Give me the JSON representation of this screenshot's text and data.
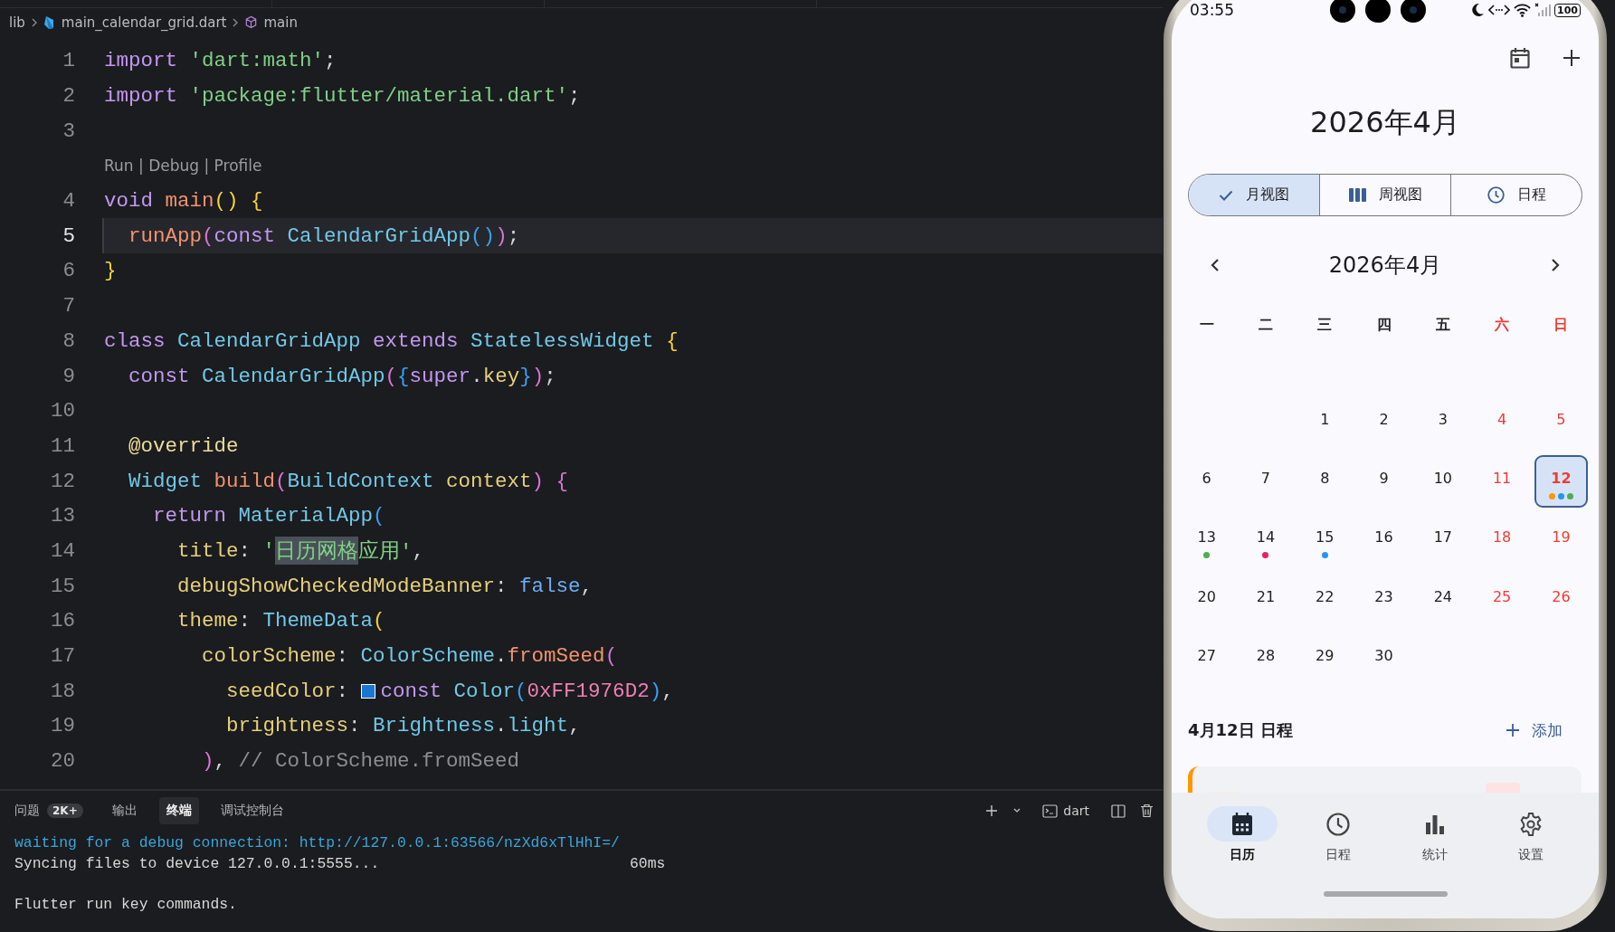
{
  "breadcrumb": [
    {
      "text": "lib",
      "kind": "folder"
    },
    {
      "text": "main_calendar_grid.dart",
      "kind": "dart"
    },
    {
      "text": "main",
      "kind": "symbol"
    }
  ],
  "editor": {
    "lines": [
      {
        "kind": "code",
        "number": "1",
        "current": false,
        "tokens": [
          {
            "text": "import ",
            "kind": "kw"
          },
          {
            "text": "'dart:math'",
            "kind": "str"
          },
          {
            "text": ";",
            "kind": "punc"
          }
        ]
      },
      {
        "kind": "code",
        "number": "2",
        "current": false,
        "tokens": [
          {
            "text": "import ",
            "kind": "kw"
          },
          {
            "text": "'package:flutter/material.dart'",
            "kind": "str"
          },
          {
            "text": ";",
            "kind": "punc"
          }
        ]
      },
      {
        "kind": "code",
        "number": "3",
        "current": false
      },
      {
        "kind": "codelens",
        "text": "Run | Debug | Profile"
      },
      {
        "kind": "code",
        "number": "4",
        "current": false,
        "tokens": [
          {
            "text": "void ",
            "kind": "kw"
          },
          {
            "text": "main",
            "kind": "fn"
          },
          {
            "text": "() {",
            "kind": "b1"
          }
        ]
      },
      {
        "kind": "code",
        "number": "5",
        "current": true,
        "tokens": [
          {
            "text": "  runApp",
            "kind": "fn"
          },
          {
            "text": "(",
            "kind": "b2"
          },
          {
            "text": "const ",
            "kind": "kw"
          },
          {
            "text": "CalendarGridApp",
            "kind": "type"
          },
          {
            "text": "()",
            "kind": "b3"
          },
          {
            "text": ")",
            "kind": "b2"
          },
          {
            "text": ";",
            "kind": "punc"
          }
        ]
      },
      {
        "kind": "code",
        "number": "6",
        "current": false,
        "tokens": [
          {
            "text": "}",
            "kind": "b1"
          }
        ]
      },
      {
        "kind": "code",
        "number": "7",
        "current": false
      },
      {
        "kind": "code",
        "number": "8",
        "current": false,
        "tokens": [
          {
            "text": "class ",
            "kind": "kw"
          },
          {
            "text": "CalendarGridApp ",
            "kind": "type"
          },
          {
            "text": "extends ",
            "kind": "kw"
          },
          {
            "text": "StatelessWidget ",
            "kind": "type"
          },
          {
            "text": "{",
            "kind": "b1"
          }
        ]
      },
      {
        "kind": "code",
        "number": "9",
        "current": false,
        "tokens": [
          {
            "text": "  const ",
            "kind": "kw"
          },
          {
            "text": "CalendarGridApp",
            "kind": "type"
          },
          {
            "text": "(",
            "kind": "b2"
          },
          {
            "text": "{",
            "kind": "b3"
          },
          {
            "text": "super",
            "kind": "kw"
          },
          {
            "text": ".",
            "kind": "punc"
          },
          {
            "text": "key",
            "kind": "prop"
          },
          {
            "text": "}",
            "kind": "b3"
          },
          {
            "text": ")",
            "kind": "b2"
          },
          {
            "text": ";",
            "kind": "punc"
          }
        ]
      },
      {
        "kind": "code",
        "number": "10",
        "current": false
      },
      {
        "kind": "code",
        "number": "11",
        "current": false,
        "tokens": [
          {
            "text": "  @override",
            "kind": "ann"
          }
        ]
      },
      {
        "kind": "code",
        "number": "12",
        "current": false,
        "tokens": [
          {
            "text": "  Widget ",
            "kind": "type"
          },
          {
            "text": "build",
            "kind": "fn"
          },
          {
            "text": "(",
            "kind": "b2"
          },
          {
            "text": "BuildContext ",
            "kind": "type"
          },
          {
            "text": "context",
            "kind": "prop"
          },
          {
            "text": ") {",
            "kind": "b2"
          }
        ]
      },
      {
        "kind": "code",
        "number": "13",
        "current": false,
        "tokens": [
          {
            "text": "    return ",
            "kind": "kw"
          },
          {
            "text": "MaterialApp",
            "kind": "type"
          },
          {
            "text": "(",
            "kind": "b3"
          }
        ]
      },
      {
        "kind": "code",
        "number": "14",
        "current": false,
        "tokens": [
          {
            "text": "      title",
            "kind": "prop"
          },
          {
            "text": ": ",
            "kind": "punc"
          },
          {
            "text": "'",
            "kind": "str"
          },
          {
            "text": "日历网格",
            "kind": "match"
          },
          {
            "text": "应用'",
            "kind": "str"
          },
          {
            "text": ",",
            "kind": "punc"
          }
        ]
      },
      {
        "kind": "code",
        "number": "15",
        "current": false,
        "tokens": [
          {
            "text": "      debugShowCheckedModeBanner",
            "kind": "prop"
          },
          {
            "text": ": ",
            "kind": "punc"
          },
          {
            "text": "false",
            "kind": "lit"
          },
          {
            "text": ",",
            "kind": "punc"
          }
        ]
      },
      {
        "kind": "code",
        "number": "16",
        "current": false,
        "tokens": [
          {
            "text": "      theme",
            "kind": "prop"
          },
          {
            "text": ": ",
            "kind": "punc"
          },
          {
            "text": "ThemeData",
            "kind": "type"
          },
          {
            "text": "(",
            "kind": "b1"
          }
        ]
      },
      {
        "kind": "code",
        "number": "17",
        "current": false,
        "tokens": [
          {
            "text": "        colorScheme",
            "kind": "prop"
          },
          {
            "text": ": ",
            "kind": "punc"
          },
          {
            "text": "ColorScheme",
            "kind": "type"
          },
          {
            "text": ".",
            "kind": "punc"
          },
          {
            "text": "fromSeed",
            "kind": "fn"
          },
          {
            "text": "(",
            "kind": "b2"
          }
        ]
      },
      {
        "kind": "code",
        "number": "18",
        "current": false,
        "tokens": [
          {
            "text": "          seedColor",
            "kind": "prop"
          },
          {
            "text": ": ",
            "kind": "punc"
          },
          {
            "kind": "swatch",
            "color": "#1976d2"
          },
          {
            "text": "const ",
            "kind": "kw"
          },
          {
            "text": "Color",
            "kind": "type"
          },
          {
            "text": "(",
            "kind": "b3"
          },
          {
            "text": "0xFF1976D2",
            "kind": "num"
          },
          {
            "text": ")",
            "kind": "b3"
          },
          {
            "text": ",",
            "kind": "punc"
          }
        ]
      },
      {
        "kind": "code",
        "number": "19",
        "current": false,
        "tokens": [
          {
            "text": "          brightness",
            "kind": "prop"
          },
          {
            "text": ": ",
            "kind": "punc"
          },
          {
            "text": "Brightness",
            "kind": "type"
          },
          {
            "text": ".",
            "kind": "punc"
          },
          {
            "text": "light",
            "kind": "type"
          },
          {
            "text": ",",
            "kind": "punc"
          }
        ]
      },
      {
        "kind": "code",
        "number": "20",
        "current": false,
        "tokens": [
          {
            "text": "        )",
            "kind": "b2"
          },
          {
            "text": ", ",
            "kind": "punc"
          },
          {
            "text": "// ColorScheme.fromSeed",
            "kind": "comment"
          }
        ]
      }
    ]
  },
  "panel": {
    "tabs": [
      {
        "label": "问题",
        "badge": "2K+",
        "selected": false
      },
      {
        "label": "输出",
        "selected": false
      },
      {
        "label": "终端",
        "selected": true
      },
      {
        "label": "调试控制台",
        "selected": false
      }
    ],
    "terminal_profile": "dart",
    "terminal": [
      {
        "kind": "info",
        "text": "waiting for a debug connection: http://127.0.0.1:63566/nzXd6xTlHhI=/",
        "gap_before": false
      },
      {
        "kind": "plain",
        "text": "Syncing files to device 127.0.0.1:5555...",
        "duration": "60ms",
        "gap_before": false
      },
      {
        "kind": "plain",
        "text": "Flutter run key commands.",
        "gap_before": true
      }
    ]
  },
  "phone": {
    "status_bar": {
      "time": "03:55",
      "battery": "100"
    },
    "title": "2026年4月",
    "view_switch": [
      {
        "label": "月视图",
        "kind": "check",
        "selected": true
      },
      {
        "label": "周视图",
        "kind": "columns",
        "selected": false
      },
      {
        "label": "日程",
        "kind": "clock",
        "selected": false
      }
    ],
    "month_nav": {
      "label": "2026年4月"
    },
    "weekdays": [
      {
        "label": "一",
        "weekend": false
      },
      {
        "label": "二",
        "weekend": false
      },
      {
        "label": "三",
        "weekend": false
      },
      {
        "label": "四",
        "weekend": false
      },
      {
        "label": "五",
        "weekend": false
      },
      {
        "label": "六",
        "weekend": true
      },
      {
        "label": "日",
        "weekend": true
      }
    ],
    "days": [
      {
        "kind": "blank"
      },
      {
        "kind": "blank"
      },
      {
        "kind": "day",
        "label": "1",
        "weekend": false,
        "selected": false
      },
      {
        "kind": "day",
        "label": "2",
        "weekend": false,
        "selected": false
      },
      {
        "kind": "day",
        "label": "3",
        "weekend": false,
        "selected": false
      },
      {
        "kind": "day",
        "label": "4",
        "weekend": true,
        "selected": false
      },
      {
        "kind": "day",
        "label": "5",
        "weekend": true,
        "selected": false
      },
      {
        "kind": "day",
        "label": "6",
        "weekend": false,
        "selected": false
      },
      {
        "kind": "day",
        "label": "7",
        "weekend": false,
        "selected": false
      },
      {
        "kind": "day",
        "label": "8",
        "weekend": false,
        "selected": false
      },
      {
        "kind": "day",
        "label": "9",
        "weekend": false,
        "selected": false
      },
      {
        "kind": "day",
        "label": "10",
        "weekend": false,
        "selected": false
      },
      {
        "kind": "day",
        "label": "11",
        "weekend": true,
        "selected": false
      },
      {
        "kind": "day",
        "label": "12",
        "weekend": true,
        "selected": true,
        "events": [
          {
            "color": "#ff9800"
          },
          {
            "color": "#2196f3"
          },
          {
            "color": "#4caf50"
          }
        ]
      },
      {
        "kind": "day",
        "label": "13",
        "weekend": false,
        "selected": false,
        "events": [
          {
            "color": "#4caf50"
          }
        ]
      },
      {
        "kind": "day",
        "label": "14",
        "weekend": false,
        "selected": false,
        "events": [
          {
            "color": "#e91e63"
          }
        ]
      },
      {
        "kind": "day",
        "label": "15",
        "weekend": false,
        "selected": false,
        "events": [
          {
            "color": "#2196f3"
          }
        ]
      },
      {
        "kind": "day",
        "label": "16",
        "weekend": false,
        "selected": false
      },
      {
        "kind": "day",
        "label": "17",
        "weekend": false,
        "selected": false
      },
      {
        "kind": "day",
        "label": "18",
        "weekend": true,
        "selected": false
      },
      {
        "kind": "day",
        "label": "19",
        "weekend": true,
        "selected": false
      },
      {
        "kind": "day",
        "label": "20",
        "weekend": false,
        "selected": false
      },
      {
        "kind": "day",
        "label": "21",
        "weekend": false,
        "selected": false
      },
      {
        "kind": "day",
        "label": "22",
        "weekend": false,
        "selected": false
      },
      {
        "kind": "day",
        "label": "23",
        "weekend": false,
        "selected": false
      },
      {
        "kind": "day",
        "label": "24",
        "weekend": false,
        "selected": false
      },
      {
        "kind": "day",
        "label": "25",
        "weekend": true,
        "selected": false
      },
      {
        "kind": "day",
        "label": "26",
        "weekend": true,
        "selected": false
      },
      {
        "kind": "day",
        "label": "27",
        "weekend": false,
        "selected": false
      },
      {
        "kind": "day",
        "label": "28",
        "weekend": false,
        "selected": false
      },
      {
        "kind": "day",
        "label": "29",
        "weekend": false,
        "selected": false
      },
      {
        "kind": "day",
        "label": "30",
        "weekend": false,
        "selected": false
      }
    ],
    "schedule": {
      "heading": "4月12日 日程",
      "add_label": "添加",
      "events": [
        {
          "color": "#ff9800"
        }
      ]
    },
    "bottom_nav": [
      {
        "label": "日历",
        "kind": "calendar",
        "selected": true
      },
      {
        "label": "日程",
        "kind": "clock",
        "selected": false
      },
      {
        "label": "统计",
        "kind": "chart",
        "selected": false
      },
      {
        "label": "设置",
        "kind": "gear",
        "selected": false
      }
    ]
  }
}
